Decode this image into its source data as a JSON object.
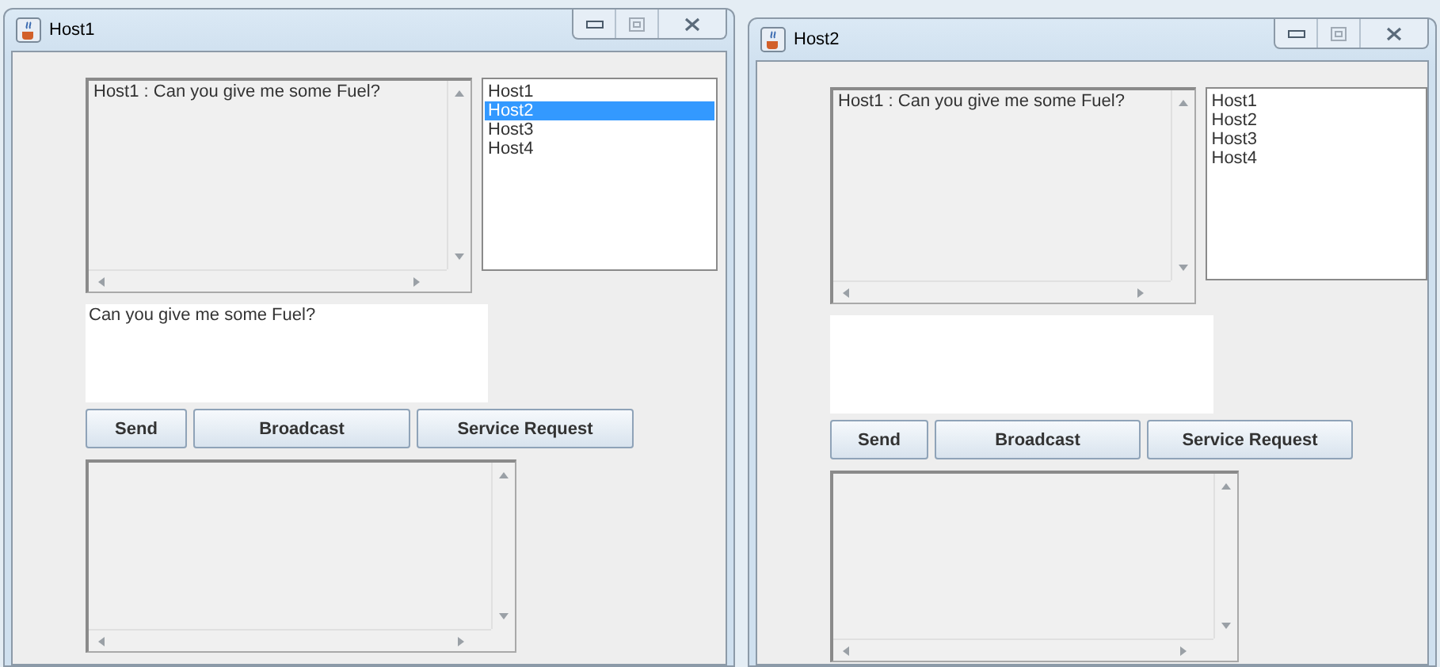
{
  "windows": [
    {
      "title": "Host1",
      "chat_log": [
        "Host1 : Can you give me some Fuel?"
      ],
      "hosts": [
        {
          "label": "Host1",
          "selected": false
        },
        {
          "label": "Host2",
          "selected": true
        },
        {
          "label": "Host3",
          "selected": false
        },
        {
          "label": "Host4",
          "selected": false
        }
      ],
      "message": {
        "value": "Can you give me some Fuel?"
      },
      "buttons": [
        "Send",
        "Broadcast",
        "Service Request"
      ]
    },
    {
      "title": "Host2",
      "chat_log": [
        "Host1 : Can you give me some Fuel?"
      ],
      "hosts": [
        {
          "label": "Host1",
          "selected": false
        },
        {
          "label": "Host2",
          "selected": false
        },
        {
          "label": "Host3",
          "selected": false
        },
        {
          "label": "Host4",
          "selected": false
        }
      ],
      "buttons": [
        "Send",
        "Broadcast",
        "Service Request"
      ]
    }
  ]
}
